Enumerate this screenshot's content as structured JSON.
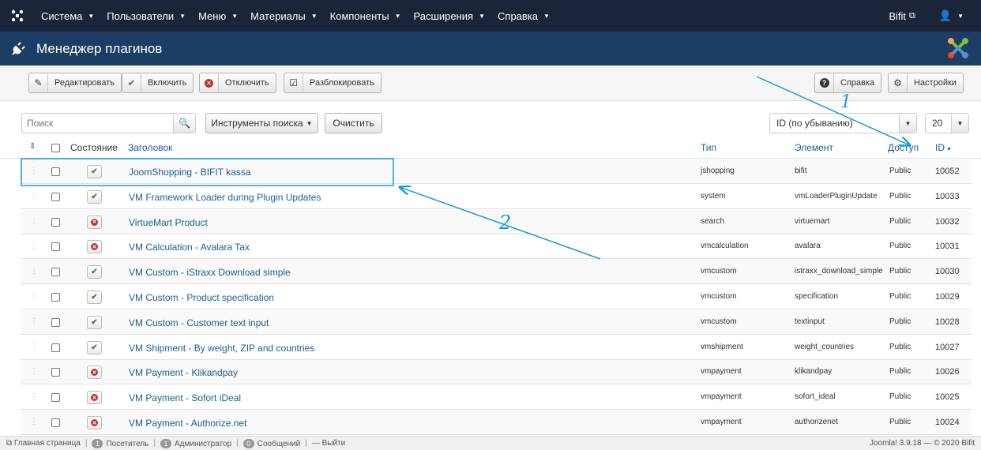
{
  "topnav": {
    "menu": [
      "Система",
      "Пользователи",
      "Меню",
      "Материалы",
      "Компоненты",
      "Расширения",
      "Справка"
    ],
    "site_link": "Bifit"
  },
  "header": {
    "title": "Менеджер плагинов"
  },
  "toolbar": {
    "edit": "Редактировать",
    "enable": "Включить",
    "disable": "Отключить",
    "unlock": "Разблокировать",
    "help": "Справка",
    "options": "Настройки"
  },
  "filters": {
    "search_placeholder": "Поиск",
    "search_tools": "Инструменты поиска",
    "clear": "Очистить",
    "ordering": "ID (по убыванию)",
    "limit": "20"
  },
  "table": {
    "columns": {
      "status": "Состояние",
      "title": "Заголовок",
      "type": "Тип",
      "element": "Элемент",
      "access": "Доступ",
      "id": "ID"
    },
    "rows": [
      {
        "title": "JoomShopping - BIFIT kassa",
        "type": "jshopping",
        "element": "bifit",
        "access": "Public",
        "id": "10052",
        "enabled": true
      },
      {
        "title": "VM Framework Loader during Plugin Updates",
        "type": "system",
        "element": "vmLoaderPluginUpdate",
        "access": "Public",
        "id": "10033",
        "enabled": true
      },
      {
        "title": "VirtueMart Product",
        "type": "search",
        "element": "virtuemart",
        "access": "Public",
        "id": "10032",
        "enabled": false
      },
      {
        "title": "VM Calculation - Avalara Tax",
        "type": "vmcalculation",
        "element": "avalara",
        "access": "Public",
        "id": "10031",
        "enabled": false
      },
      {
        "title": "VM Custom - iStraxx Download simple",
        "type": "vmcustom",
        "element": "istraxx_download_simple",
        "access": "Public",
        "id": "10030",
        "enabled": true
      },
      {
        "title": "VM Custom - Product specification",
        "type": "vmcustom",
        "element": "specification",
        "access": "Public",
        "id": "10029",
        "enabled": true
      },
      {
        "title": "VM Custom - Customer text input",
        "type": "vmcustom",
        "element": "textinput",
        "access": "Public",
        "id": "10028",
        "enabled": true
      },
      {
        "title": "VM Shipment - By weight, ZIP and countries",
        "type": "vmshipment",
        "element": "weight_countries",
        "access": "Public",
        "id": "10027",
        "enabled": true
      },
      {
        "title": "VM Payment - Klikandpay",
        "type": "vmpayment",
        "element": "klikandpay",
        "access": "Public",
        "id": "10026",
        "enabled": false
      },
      {
        "title": "VM Payment - Sofort iDeal",
        "type": "vmpayment",
        "element": "sofort_ideal",
        "access": "Public",
        "id": "10025",
        "enabled": false
      },
      {
        "title": "VM Payment - Authorize.net",
        "type": "vmpayment",
        "element": "authorizenet",
        "access": "Public",
        "id": "10024",
        "enabled": false
      }
    ]
  },
  "statusbar": {
    "home": "Главная страница",
    "visitors_count": "1",
    "visitors": "Посетитель",
    "admins_count": "1",
    "admins": "Администратор",
    "messages_count": "0",
    "messages": "Сообщений",
    "logout": "Выйти",
    "version": "Joomla! 3.9.18 — © 2020 Bifit"
  },
  "annotations": {
    "label1": "1",
    "label2": "2",
    "color": "#1a9ad6"
  }
}
